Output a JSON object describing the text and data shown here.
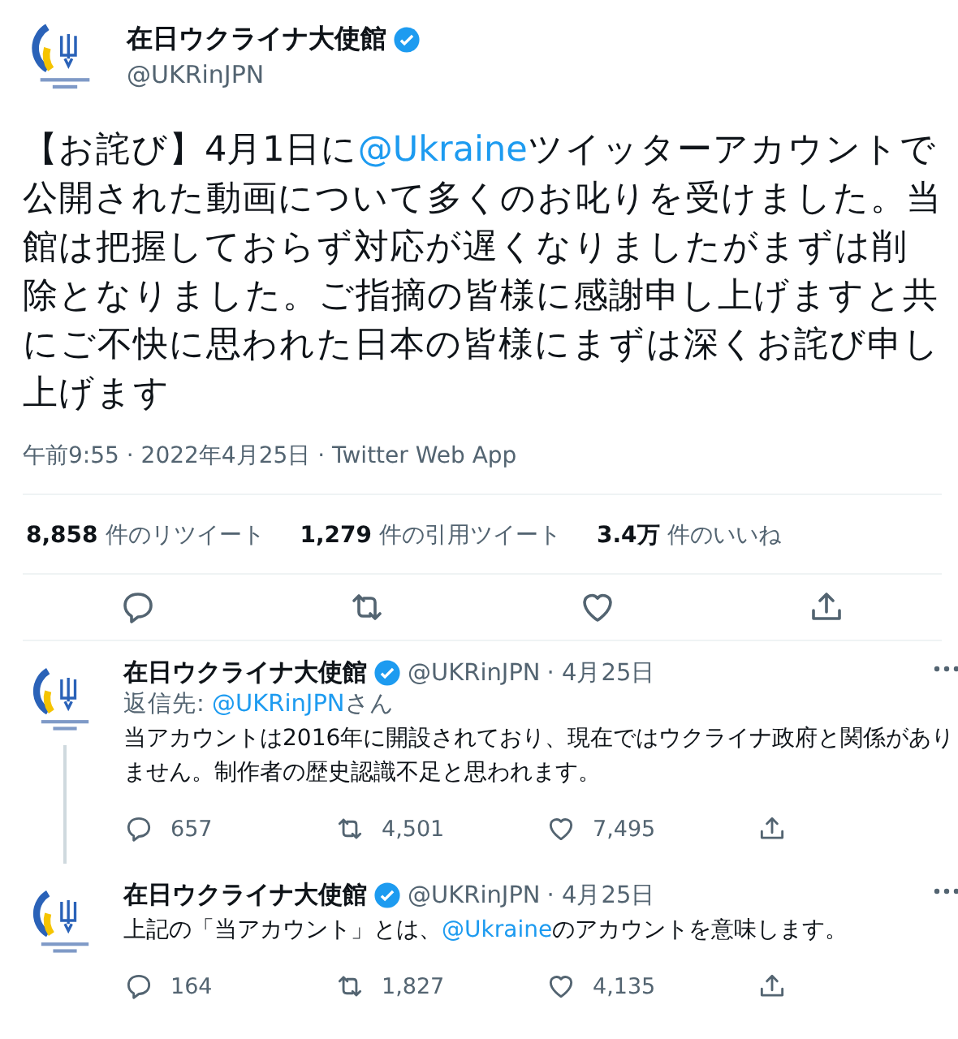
{
  "tweet": {
    "name": "在日ウクライナ大使館",
    "verified": true,
    "handle": "@UKRinJPN",
    "body": [
      {
        "text": "【お詫び】4月1日に",
        "kind": "text"
      },
      {
        "text": "@Ukraine",
        "kind": "mention"
      },
      {
        "text": "ツイッターアカウントで公開された動画について多くのお叱りを受けました。当館は把握しておらず対応が遅くなりましたがまずは削除となりました。ご指摘の皆様に感謝申し上げますと共にご不快に思われた日本の皆様にまずは深くお詫び申し上げます",
        "kind": "text"
      }
    ],
    "meta": "午前9:55 · 2022年4月25日 · Twitter Web App",
    "stats": [
      {
        "count": "8,858",
        "label": "件のリツイート"
      },
      {
        "count": "1,279",
        "label": "件の引用ツイート"
      },
      {
        "count": "3.4万",
        "label": "件のいいね"
      }
    ]
  },
  "replies": [
    {
      "name": "在日ウクライナ大使館",
      "verified": true,
      "handle": "@UKRinJPN",
      "date": "· 4月25日",
      "thread": true,
      "reply_to": {
        "prefix": "返信先: ",
        "handle": "@UKRinJPN",
        "suffix": "さん"
      },
      "body": [
        {
          "text": "当アカウントは2016年に開設されており、現在ではウクライナ政府と関係がありません。制作者の歴史認識不足と思われます。",
          "kind": "text"
        }
      ],
      "counts": [
        "657",
        "4,501",
        "7,495"
      ]
    },
    {
      "name": "在日ウクライナ大使館",
      "verified": true,
      "handle": "@UKRinJPN",
      "date": "· 4月25日",
      "thread": false,
      "body": [
        {
          "text": "上記の「当アカウント」とは、",
          "kind": "text"
        },
        {
          "text": "@Ukraine",
          "kind": "mention"
        },
        {
          "text": "のアカウントを意味します。",
          "kind": "text"
        }
      ],
      "counts": [
        "164",
        "1,827",
        "4,135"
      ]
    }
  ]
}
